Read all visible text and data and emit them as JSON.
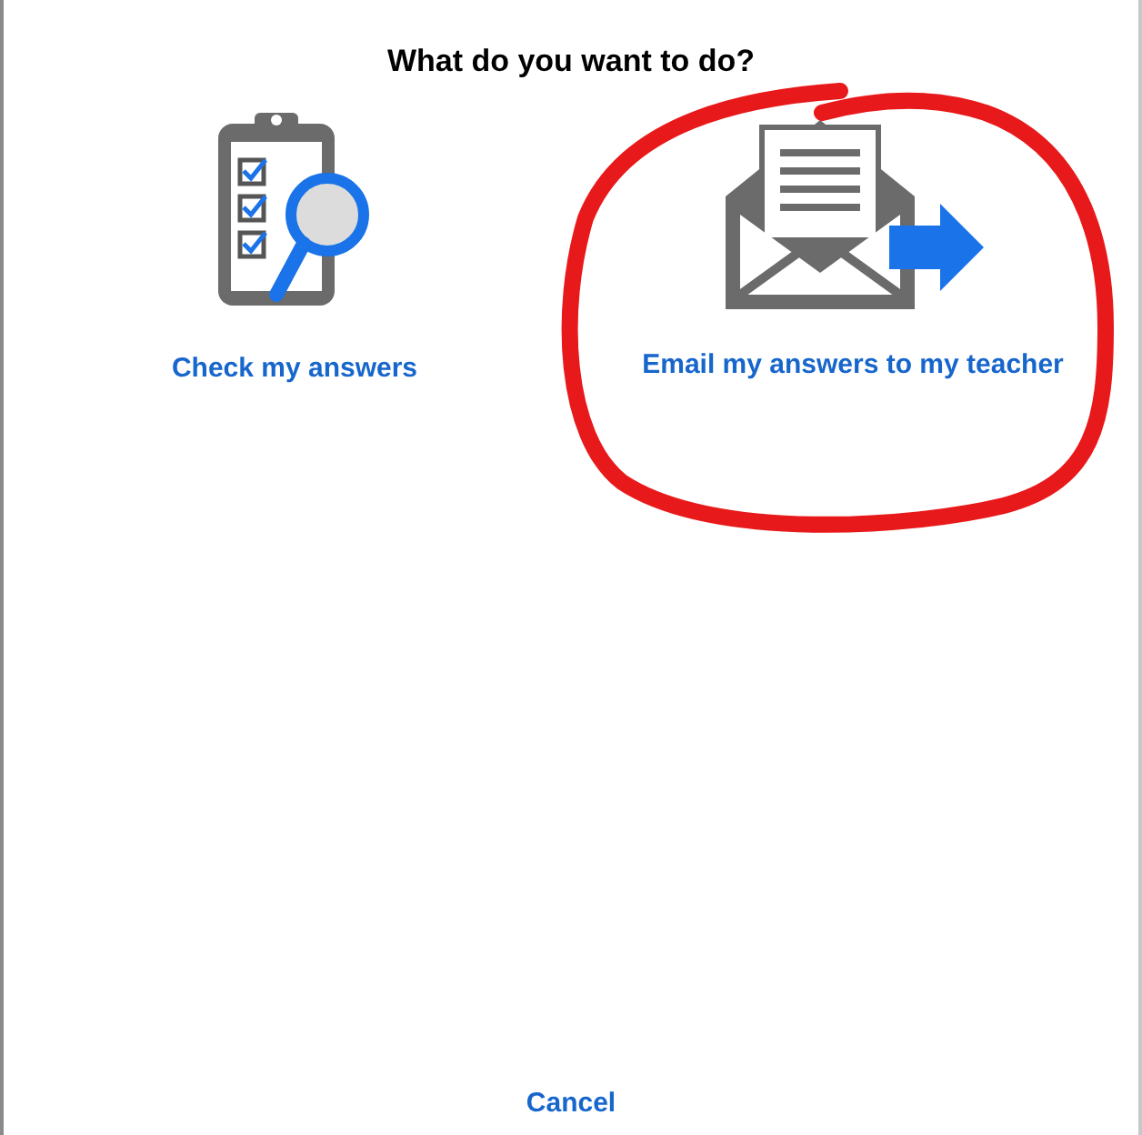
{
  "dialog": {
    "title": "What do you want to do?"
  },
  "options": [
    {
      "kind": "check",
      "label": "Check my answers",
      "circled": false
    },
    {
      "kind": "email",
      "label": "Email my answers to my teacher",
      "circled": true
    }
  ],
  "cancel": {
    "label": "Cancel"
  }
}
